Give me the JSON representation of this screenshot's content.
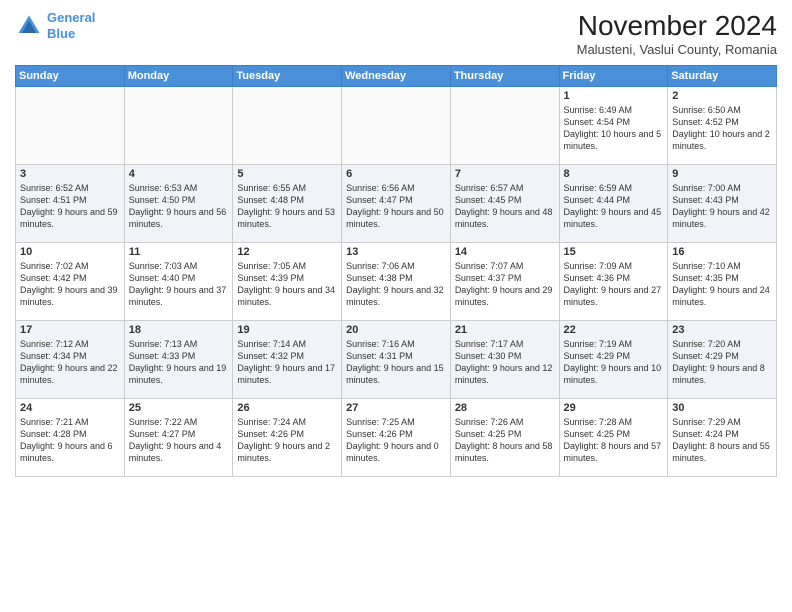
{
  "header": {
    "logo_line1": "General",
    "logo_line2": "Blue",
    "month": "November 2024",
    "location": "Malusteni, Vaslui County, Romania"
  },
  "weekdays": [
    "Sunday",
    "Monday",
    "Tuesday",
    "Wednesday",
    "Thursday",
    "Friday",
    "Saturday"
  ],
  "weeks": [
    [
      {
        "day": "",
        "info": ""
      },
      {
        "day": "",
        "info": ""
      },
      {
        "day": "",
        "info": ""
      },
      {
        "day": "",
        "info": ""
      },
      {
        "day": "",
        "info": ""
      },
      {
        "day": "1",
        "info": "Sunrise: 6:49 AM\nSunset: 4:54 PM\nDaylight: 10 hours and 5 minutes."
      },
      {
        "day": "2",
        "info": "Sunrise: 6:50 AM\nSunset: 4:52 PM\nDaylight: 10 hours and 2 minutes."
      }
    ],
    [
      {
        "day": "3",
        "info": "Sunrise: 6:52 AM\nSunset: 4:51 PM\nDaylight: 9 hours and 59 minutes."
      },
      {
        "day": "4",
        "info": "Sunrise: 6:53 AM\nSunset: 4:50 PM\nDaylight: 9 hours and 56 minutes."
      },
      {
        "day": "5",
        "info": "Sunrise: 6:55 AM\nSunset: 4:48 PM\nDaylight: 9 hours and 53 minutes."
      },
      {
        "day": "6",
        "info": "Sunrise: 6:56 AM\nSunset: 4:47 PM\nDaylight: 9 hours and 50 minutes."
      },
      {
        "day": "7",
        "info": "Sunrise: 6:57 AM\nSunset: 4:45 PM\nDaylight: 9 hours and 48 minutes."
      },
      {
        "day": "8",
        "info": "Sunrise: 6:59 AM\nSunset: 4:44 PM\nDaylight: 9 hours and 45 minutes."
      },
      {
        "day": "9",
        "info": "Sunrise: 7:00 AM\nSunset: 4:43 PM\nDaylight: 9 hours and 42 minutes."
      }
    ],
    [
      {
        "day": "10",
        "info": "Sunrise: 7:02 AM\nSunset: 4:42 PM\nDaylight: 9 hours and 39 minutes."
      },
      {
        "day": "11",
        "info": "Sunrise: 7:03 AM\nSunset: 4:40 PM\nDaylight: 9 hours and 37 minutes."
      },
      {
        "day": "12",
        "info": "Sunrise: 7:05 AM\nSunset: 4:39 PM\nDaylight: 9 hours and 34 minutes."
      },
      {
        "day": "13",
        "info": "Sunrise: 7:06 AM\nSunset: 4:38 PM\nDaylight: 9 hours and 32 minutes."
      },
      {
        "day": "14",
        "info": "Sunrise: 7:07 AM\nSunset: 4:37 PM\nDaylight: 9 hours and 29 minutes."
      },
      {
        "day": "15",
        "info": "Sunrise: 7:09 AM\nSunset: 4:36 PM\nDaylight: 9 hours and 27 minutes."
      },
      {
        "day": "16",
        "info": "Sunrise: 7:10 AM\nSunset: 4:35 PM\nDaylight: 9 hours and 24 minutes."
      }
    ],
    [
      {
        "day": "17",
        "info": "Sunrise: 7:12 AM\nSunset: 4:34 PM\nDaylight: 9 hours and 22 minutes."
      },
      {
        "day": "18",
        "info": "Sunrise: 7:13 AM\nSunset: 4:33 PM\nDaylight: 9 hours and 19 minutes."
      },
      {
        "day": "19",
        "info": "Sunrise: 7:14 AM\nSunset: 4:32 PM\nDaylight: 9 hours and 17 minutes."
      },
      {
        "day": "20",
        "info": "Sunrise: 7:16 AM\nSunset: 4:31 PM\nDaylight: 9 hours and 15 minutes."
      },
      {
        "day": "21",
        "info": "Sunrise: 7:17 AM\nSunset: 4:30 PM\nDaylight: 9 hours and 12 minutes."
      },
      {
        "day": "22",
        "info": "Sunrise: 7:19 AM\nSunset: 4:29 PM\nDaylight: 9 hours and 10 minutes."
      },
      {
        "day": "23",
        "info": "Sunrise: 7:20 AM\nSunset: 4:29 PM\nDaylight: 9 hours and 8 minutes."
      }
    ],
    [
      {
        "day": "24",
        "info": "Sunrise: 7:21 AM\nSunset: 4:28 PM\nDaylight: 9 hours and 6 minutes."
      },
      {
        "day": "25",
        "info": "Sunrise: 7:22 AM\nSunset: 4:27 PM\nDaylight: 9 hours and 4 minutes."
      },
      {
        "day": "26",
        "info": "Sunrise: 7:24 AM\nSunset: 4:26 PM\nDaylight: 9 hours and 2 minutes."
      },
      {
        "day": "27",
        "info": "Sunrise: 7:25 AM\nSunset: 4:26 PM\nDaylight: 9 hours and 0 minutes."
      },
      {
        "day": "28",
        "info": "Sunrise: 7:26 AM\nSunset: 4:25 PM\nDaylight: 8 hours and 58 minutes."
      },
      {
        "day": "29",
        "info": "Sunrise: 7:28 AM\nSunset: 4:25 PM\nDaylight: 8 hours and 57 minutes."
      },
      {
        "day": "30",
        "info": "Sunrise: 7:29 AM\nSunset: 4:24 PM\nDaylight: 8 hours and 55 minutes."
      }
    ]
  ]
}
